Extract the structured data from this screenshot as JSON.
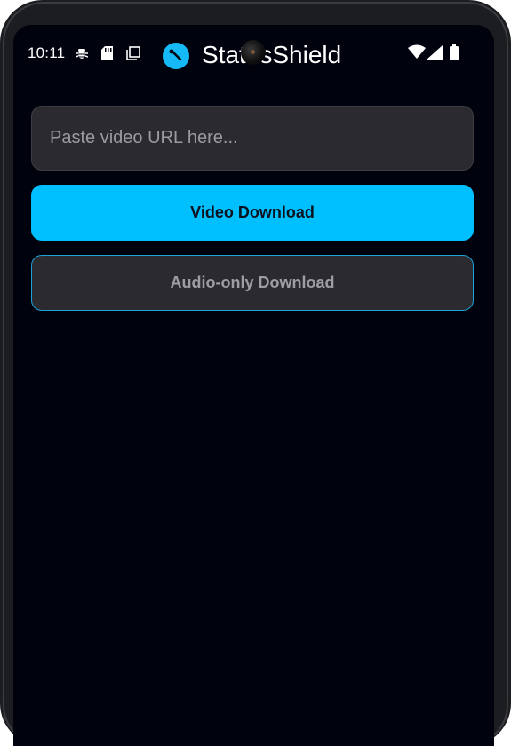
{
  "status_bar": {
    "time": "10:11"
  },
  "app": {
    "title": "StatusShield",
    "accent_color": "#00bfff"
  },
  "url_input": {
    "value": "",
    "placeholder": "Paste video URL here..."
  },
  "actions": {
    "video_download_label": "Video Download",
    "audio_download_label": "Audio-only Download"
  },
  "icons": {
    "status_left": [
      "bug-icon",
      "sd-card-icon",
      "copy-icon"
    ],
    "status_right": [
      "wifi-icon",
      "signal-icon",
      "battery-icon"
    ],
    "logo": "app-logo-icon"
  }
}
